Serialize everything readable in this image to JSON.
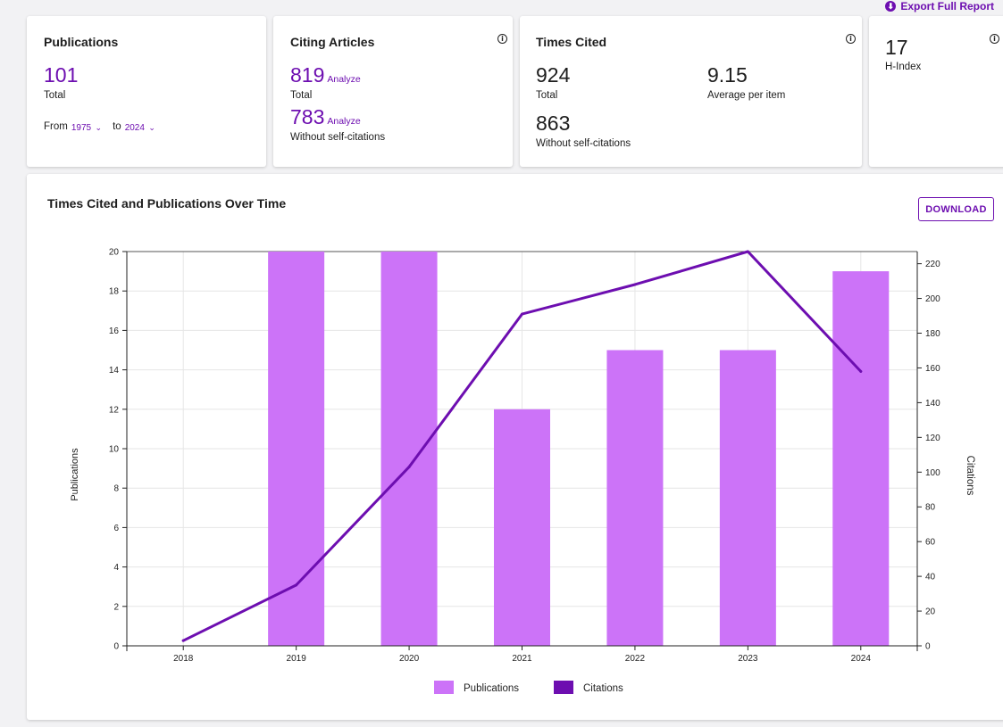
{
  "header": {
    "export_label": "Export Full Report",
    "export_icon": "download-icon"
  },
  "publications": {
    "title": "Publications",
    "value": "101",
    "value_label": "Total",
    "from_label": "From",
    "from_value": "1975",
    "to_label": "to",
    "to_value": "2024"
  },
  "citing": {
    "title": "Citing Articles",
    "total": "819",
    "total_label": "Total",
    "without": "783",
    "without_label": "Without self-citations",
    "analyze_label": "Analyze"
  },
  "times_cited": {
    "title": "Times Cited",
    "total": "924",
    "total_label": "Total",
    "average": "9.15",
    "average_label": "Average per item",
    "without": "863",
    "without_label": "Without self-citations"
  },
  "hindex": {
    "value": "17",
    "label": "H-Index"
  },
  "chart_section": {
    "title": "Times Cited and Publications Over Time",
    "download_label": "DOWNLOAD"
  },
  "colors": {
    "accent": "#6d0eb0",
    "bar": "#cc73f8",
    "line": "#6d0eb0"
  },
  "chart_data": {
    "type": "bar",
    "categories": [
      "2018",
      "2019",
      "2020",
      "2021",
      "2022",
      "2023",
      "2024"
    ],
    "series": [
      {
        "name": "Publications",
        "type": "bar",
        "axis": "left",
        "values": [
          0,
          20,
          20,
          12,
          15,
          15,
          19
        ]
      },
      {
        "name": "Citations",
        "type": "line",
        "axis": "right",
        "values": [
          3,
          35,
          103,
          191,
          208,
          227,
          158
        ]
      }
    ],
    "ylabel": "Publications",
    "y2label": "Citations",
    "ylim": [
      0,
      20
    ],
    "y2lim": [
      0,
      227
    ],
    "yticks": [
      0,
      2,
      4,
      6,
      8,
      10,
      12,
      14,
      16,
      18,
      20
    ],
    "y2ticks": [
      0,
      20,
      40,
      60,
      80,
      100,
      120,
      140,
      160,
      180,
      200,
      220
    ],
    "grid": true,
    "legend": "bottom"
  }
}
